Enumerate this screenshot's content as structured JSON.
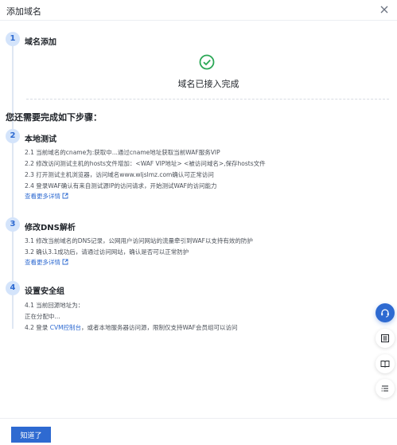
{
  "dialog": {
    "title": "添加域名",
    "ok_label": "知道了"
  },
  "step1": {
    "number": "1",
    "title": "域名添加",
    "status_text": "域名已接入完成"
  },
  "section_heading": "您还需要完成如下步骤：",
  "step2": {
    "number": "2",
    "title": "本地测试",
    "lines": [
      "2.1 当前域名的cname为:获取中...通过cname地址获取当前WAF服务VIP",
      "2.2 修改访问测试主机的hosts文件增加：<WAF VIP地址> <被访问域名>,保存hosts文件",
      "2.3 打开测试主机浏览器，访问域名www.wljslmz.com确认可正常访问",
      "2.4 登录WAF确认有来自测试源IP的访问请求，开始测试WAF的访问能力"
    ],
    "more_label": "查看更多详情"
  },
  "step3": {
    "number": "3",
    "title": "修改DNS解析",
    "lines": [
      "3.1 修改当前域名的DNS记录，公网用户访问网站的流量牵引到WAF以支持有效的防护",
      "3.2 确认3.1成功后，请通过访问网站，确认是否可以正常防护"
    ],
    "more_label": "查看更多详情"
  },
  "step4": {
    "number": "4",
    "title": "设置安全组",
    "line1": "4.1 当前回源地址为：",
    "line2": "正在分配中...",
    "line3_prefix": "4.2 登录 ",
    "line3_link": "CVM控制台",
    "line3_suffix": "，或者本地服务器访问源，限制仅支持WAF会员组可以访问"
  },
  "colors": {
    "accent": "#2e6ad1",
    "success": "#2aa755",
    "step_badge_bg": "#d4e4fb"
  },
  "icons": [
    "close-icon",
    "check-circle-icon",
    "external-link-icon",
    "headset-icon",
    "document-list-icon",
    "book-icon",
    "outline-list-icon"
  ]
}
